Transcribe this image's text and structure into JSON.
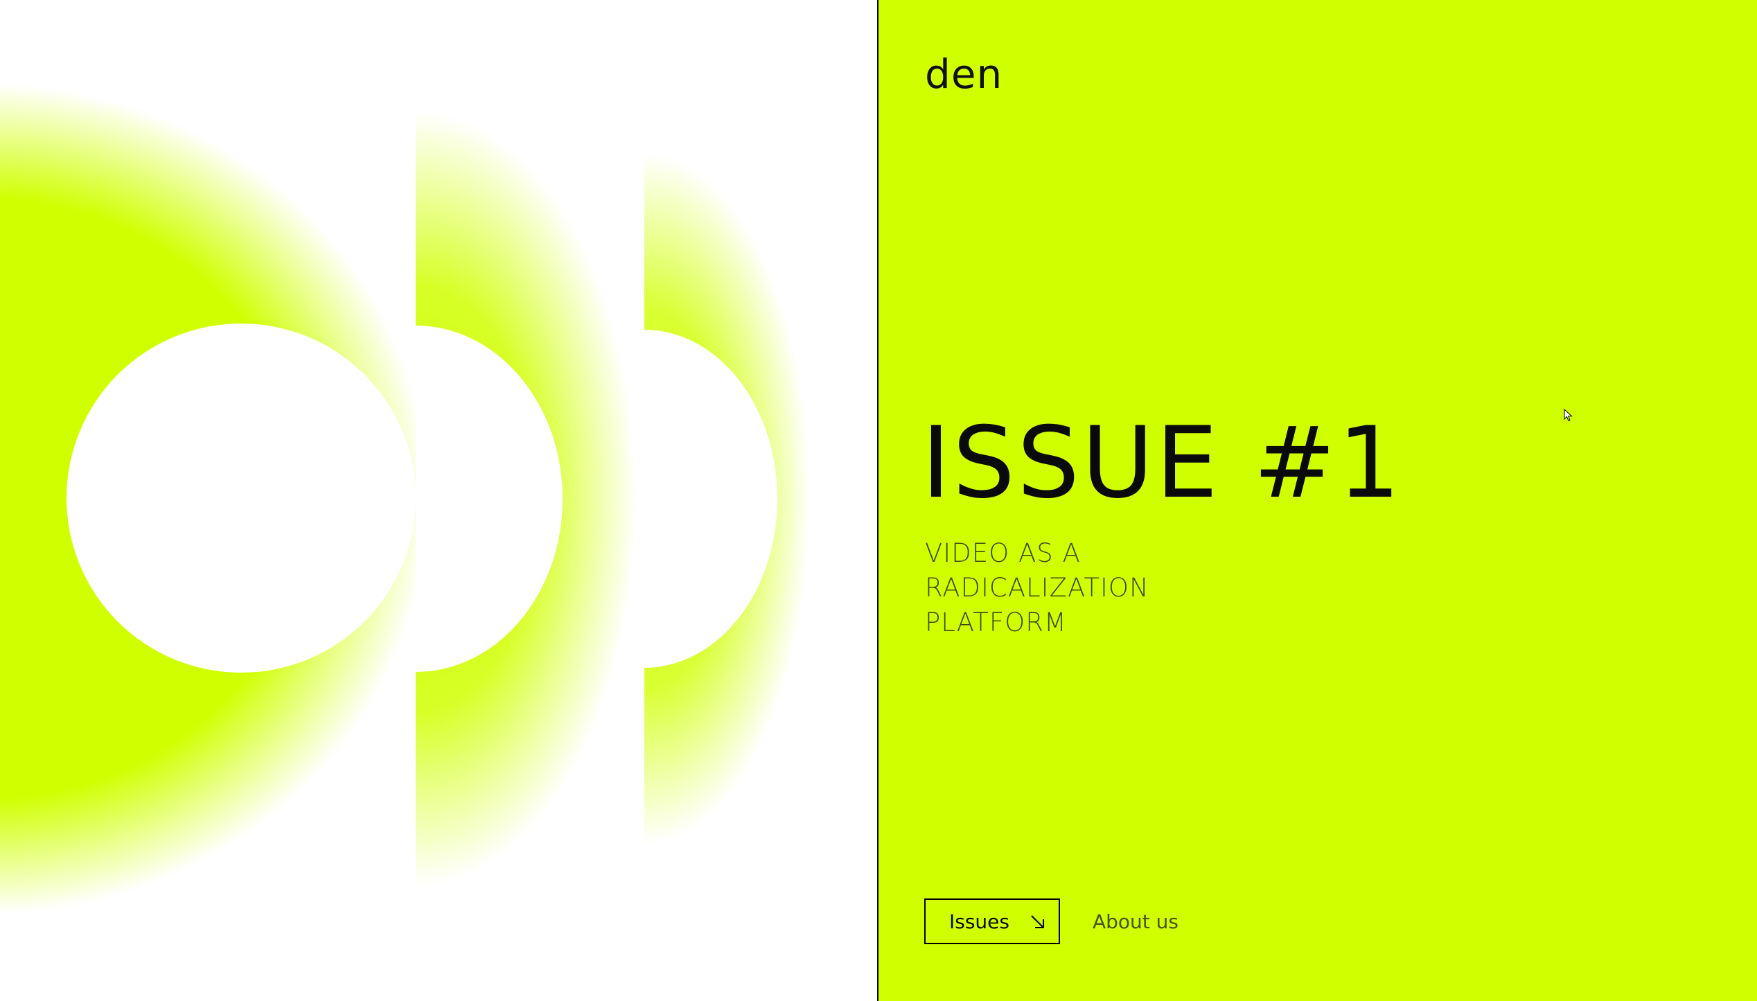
{
  "brand": {
    "logo_text": "den"
  },
  "hero": {
    "title": "ISSUE #1",
    "subtitle_lines": [
      "VIDEO AS A",
      "RADICALIZATION",
      "PLATFORM"
    ]
  },
  "nav": {
    "issues_label": "Issues",
    "issues_icon": "arrow-down-right-icon",
    "about_label": "About us"
  },
  "colors": {
    "accent": "#d0ff00",
    "text": "#0a0a0a",
    "background": "#ffffff"
  }
}
